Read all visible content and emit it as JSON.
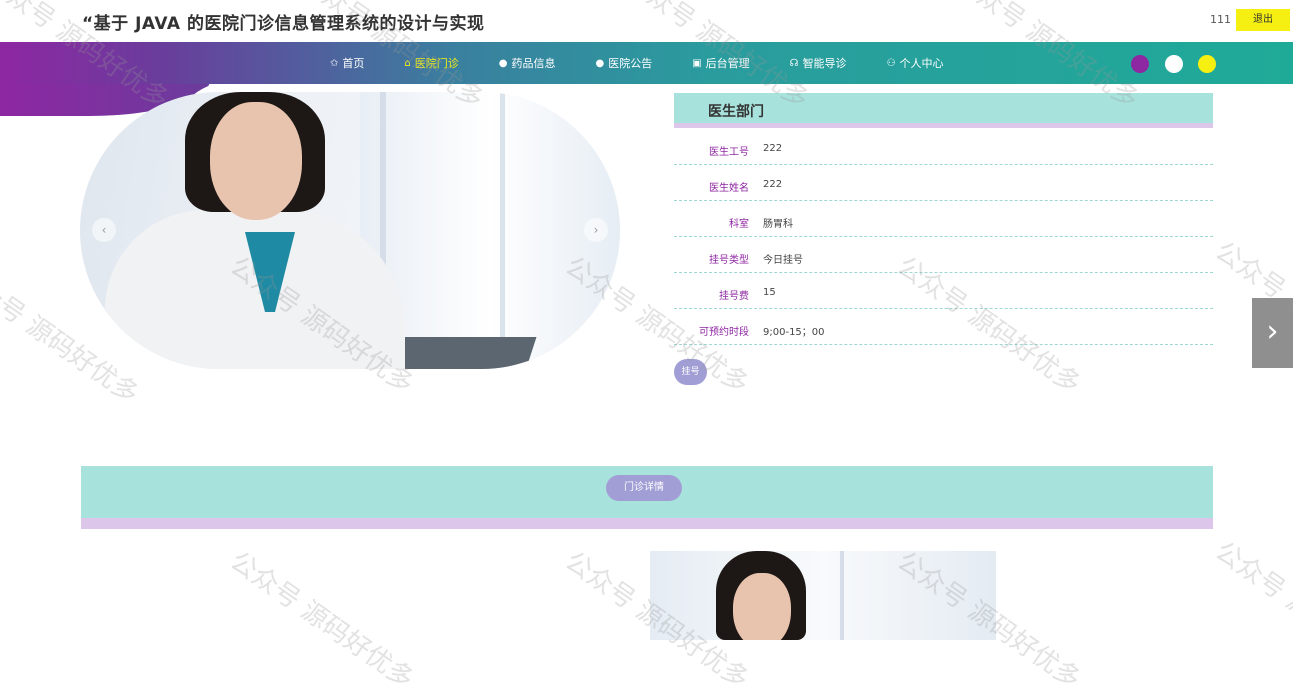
{
  "header": {
    "title": "“基于 JAVA 的医院门诊信息管理系统的设计与实现",
    "username": "111",
    "logout_label": "退出"
  },
  "nav": {
    "items": [
      {
        "icon": "star-icon",
        "glyph": "✩",
        "label": "首页",
        "active": false
      },
      {
        "icon": "bag-icon",
        "glyph": "⌂",
        "label": "医院门诊",
        "active": true
      },
      {
        "icon": "info-icon",
        "glyph": "●",
        "label": "药品信息",
        "active": false
      },
      {
        "icon": "notice-icon",
        "glyph": "●",
        "label": "医院公告",
        "active": false
      },
      {
        "icon": "admin-icon",
        "glyph": "▣",
        "label": "后台管理",
        "active": false
      },
      {
        "icon": "headset-icon",
        "glyph": "☊",
        "label": "智能导诊",
        "active": false
      },
      {
        "icon": "user-icon",
        "glyph": "⚇",
        "label": "个人中心",
        "active": false
      }
    ],
    "theme_colors": [
      "#8e27a2",
      "#ffffff",
      "#f5ef12"
    ]
  },
  "carousel": {
    "prev_glyph": "‹",
    "next_glyph": "›"
  },
  "doctor_panel": {
    "title": "医生部门",
    "fields": [
      {
        "label": "医生工号",
        "value": "222"
      },
      {
        "label": "医生姓名",
        "value": "222"
      },
      {
        "label": "科室",
        "value": "肠胃科"
      },
      {
        "label": "挂号类型",
        "value": "今日挂号"
      },
      {
        "label": "挂号费",
        "value": "15"
      },
      {
        "label": "可预约时段",
        "value": "9;00-15；00"
      }
    ],
    "register_label": "挂号"
  },
  "side_next_glyph": "›",
  "detail": {
    "tab_label": "门诊详情"
  },
  "watermark": "公众号 源码好优多",
  "colors": {
    "accent_purple": "#8e27a2",
    "accent_teal": "#1faa98",
    "accent_yellow": "#f5ef12",
    "panel_teal": "#a8e2dc",
    "panel_lilac": "#dcc6ea",
    "button_violet": "#a09ed4"
  }
}
